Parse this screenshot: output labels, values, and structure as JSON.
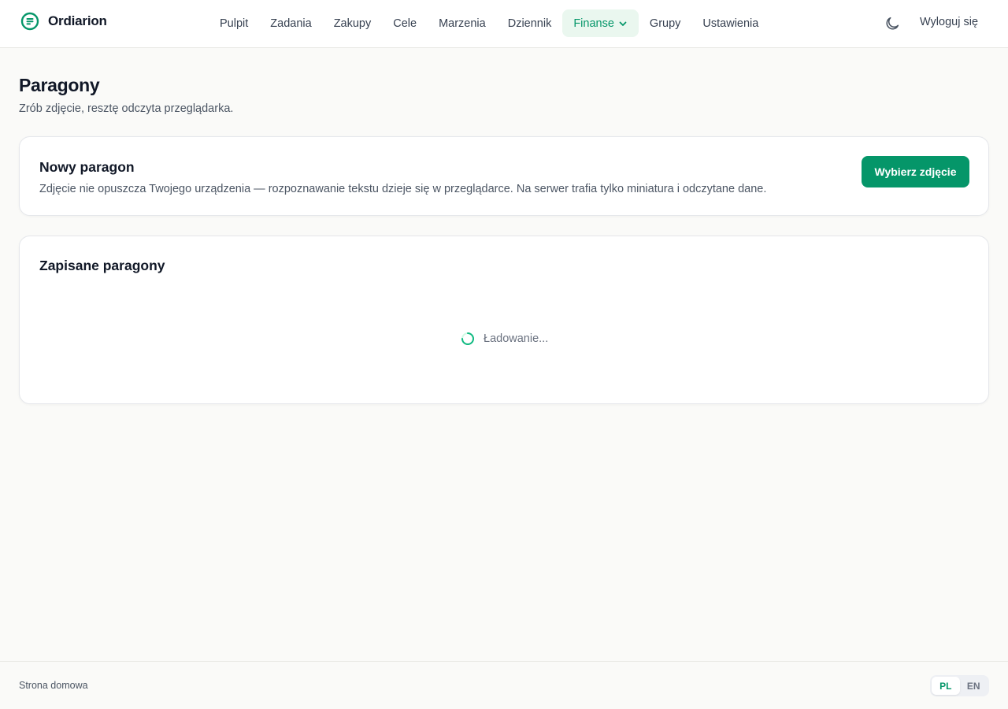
{
  "header": {
    "brand": "Ordiarion",
    "nav": [
      {
        "label": "Pulpit"
      },
      {
        "label": "Zadania"
      },
      {
        "label": "Zakupy"
      },
      {
        "label": "Cele"
      },
      {
        "label": "Marzenia"
      },
      {
        "label": "Dziennik"
      },
      {
        "label": "Finanse",
        "active": true,
        "has_dropdown": true
      },
      {
        "label": "Grupy"
      },
      {
        "label": "Ustawienia"
      }
    ],
    "theme_toggle_icon": "moon-icon",
    "logout_label": "Wyloguj się"
  },
  "page": {
    "title": "Paragony",
    "subtitle": "Zrób zdjęcie, resztę odczyta przeglądarka."
  },
  "new_receipt": {
    "title": "Nowy paragon",
    "description": "Zdjęcie nie opuszcza Twojego urządzenia — rozpoznawanie tekstu dzieje się w przeglądarce. Na serwer trafia tylko miniatura i odczytane dane.",
    "button_label": "Wybierz zdjęcie"
  },
  "saved_receipts": {
    "title": "Zapisane paragony",
    "loading_text": "Ładowanie..."
  },
  "footer": {
    "home_link": "Strona domowa",
    "languages": [
      {
        "label": "PL",
        "active": true
      },
      {
        "label": "EN",
        "active": false
      }
    ]
  },
  "colors": {
    "accent": "#059669",
    "accent_soft": "#eaf7ef",
    "background": "#fafaf8"
  }
}
